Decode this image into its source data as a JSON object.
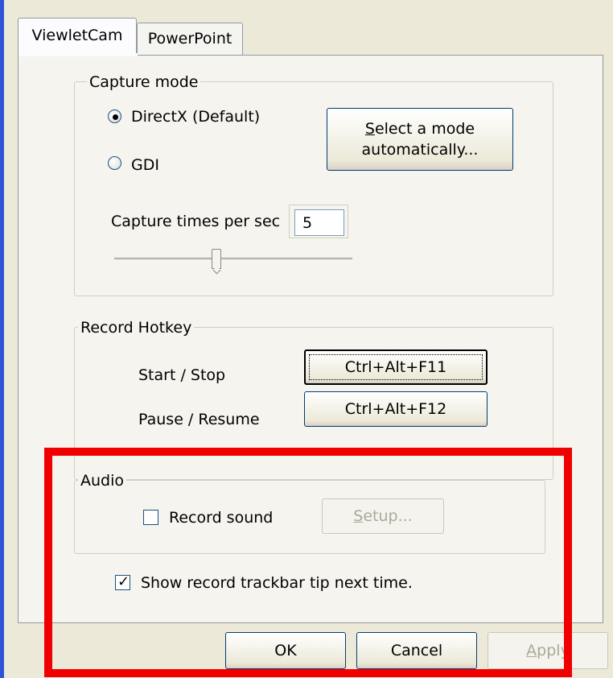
{
  "tabs": [
    {
      "label": "ViewletCam",
      "active": true
    },
    {
      "label": "PowerPoint",
      "active": false
    }
  ],
  "capture_mode": {
    "title": "Capture mode",
    "options": [
      {
        "label": "DirectX (Default)",
        "selected": true
      },
      {
        "label": "GDI",
        "selected": false
      }
    ],
    "auto_button": {
      "accel": "S",
      "line1_rest": "elect a mode",
      "line2": "automatically..."
    },
    "times_label": "Capture times per sec",
    "times_value": "5",
    "slider_level_fraction": 0.43
  },
  "hotkey": {
    "title": "Record Hotkey",
    "start_stop_label": "Start / Stop",
    "start_stop_value": "Ctrl+Alt+F11",
    "pause_resume_label": "Pause / Resume",
    "pause_resume_value": "Ctrl+Alt+F12"
  },
  "audio": {
    "title": "Audio",
    "record_sound_label": "Record sound",
    "record_sound_checked": false,
    "setup_accel": "S",
    "setup_rest": "etup..."
  },
  "trackbar_tip": {
    "label": "Show record trackbar tip next time.",
    "checked": true,
    "mark": "✓"
  },
  "footer": {
    "ok": "OK",
    "cancel": "Cancel",
    "apply_accel": "A",
    "apply_rest": "pply"
  },
  "colors": {
    "highlight": "#f00000",
    "window_edge": "#2f54d6",
    "dialog_bg": "#ece9d8"
  }
}
